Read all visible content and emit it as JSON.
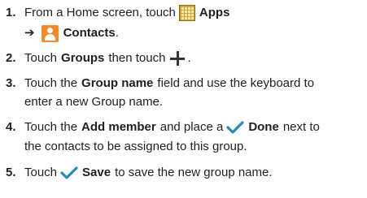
{
  "steps": [
    {
      "number": "1.",
      "line1": {
        "t1": "From a Home screen, touch",
        "apps_label": "Apps"
      },
      "line2": {
        "arrow": "➔",
        "contacts_label": "Contacts",
        "end": "."
      }
    },
    {
      "number": "2.",
      "line1": {
        "t1": "Touch",
        "groups": "Groups",
        "t2": "then touch",
        "end": "."
      }
    },
    {
      "number": "3.",
      "line1": {
        "t1": "Touch the",
        "group_name": "Group name",
        "t2": "field and use the keyboard to"
      },
      "line2": {
        "t1": "enter a new Group name."
      }
    },
    {
      "number": "4.",
      "line1": {
        "t1": "Touch the",
        "add_member": "Add member",
        "t2": "and place a",
        "done": "Done",
        "t3": "next to"
      },
      "line2": {
        "t1": "the contacts to be assigned to this group."
      }
    },
    {
      "number": "5.",
      "line1": {
        "t1": "Touch",
        "save": "Save",
        "t2": "to save the new group name."
      }
    }
  ],
  "icons": {
    "apps": "apps-grid-icon",
    "contacts": "contacts-icon",
    "plus": "plus-icon",
    "check": "checkmark-icon"
  },
  "colors": {
    "text": "#1f1f1f",
    "apps_icon": "#c8a43a",
    "contacts_icon": "#f08a2a",
    "check": "#2a8ab0"
  }
}
